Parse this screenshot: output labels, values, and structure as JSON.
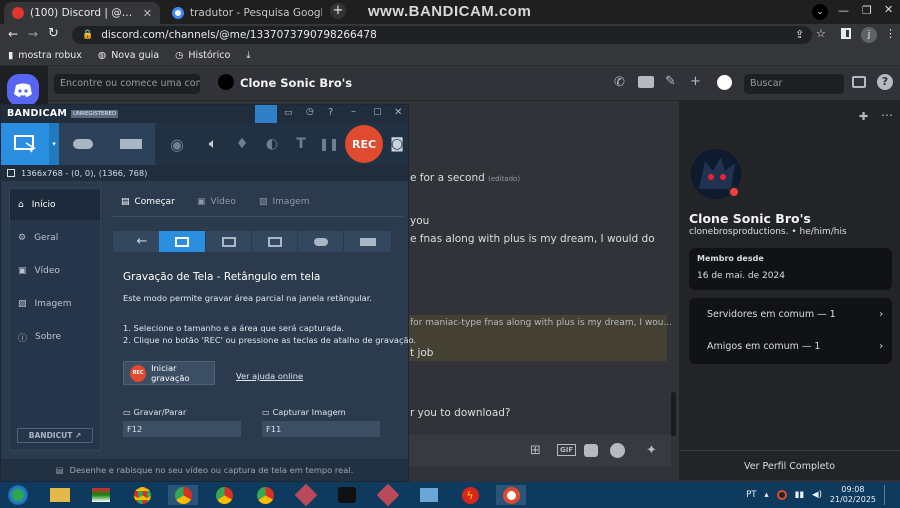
{
  "watermark": "www.BANDICAM.com",
  "browser": {
    "tabs": [
      {
        "title": "(100) Discord | @Clone Sonic Bro's",
        "favicon_color": "#e0342c"
      },
      {
        "title": "tradutor - Pesquisa Google",
        "favicon_color": "#ffffff"
      }
    ],
    "url": "discord.com/channels/@me/1337073790798266478",
    "profile_letter": "j",
    "bookmarks": [
      "mostra robux",
      "Nova guia",
      "Histórico"
    ]
  },
  "discord": {
    "search_dm_placeholder": "Encontre ou comece uma conver…",
    "channel_name": "Clone Sonic Bro's",
    "search_placeholder": "Buscar",
    "messages": [
      {
        "text": "e for a second",
        "edited": "(editado)"
      },
      {
        "text": "you"
      },
      {
        "text": "e fnas along with plus is my dream, I would do"
      },
      {
        "text": "for maniac-type fnas along with plus is my dream, I wou..."
      },
      {
        "text": "t job"
      },
      {
        "text": "r you to download?"
      }
    ],
    "profile": {
      "display_name": "Clone Sonic Bro's",
      "username": "clonebrosproductions.",
      "pronouns": "he/him/his",
      "member_since_label": "Membro desde",
      "member_since": "16 de mai. de 2024",
      "mutual_servers": "Servidores em comum — 1",
      "mutual_friends": "Amigos em comum — 1",
      "view_full_profile": "Ver Perfil Completo"
    }
  },
  "bandicam": {
    "brand": "BANDICAM",
    "badge": "UNREGISTERED",
    "rec_label": "REC",
    "resolution": "1366x768 - (0, 0), (1366, 768)",
    "sidebar": [
      "Início",
      "Geral",
      "Vídeo",
      "Imagem",
      "Sobre"
    ],
    "bandicut": "BANDICUT ↗",
    "tabs": [
      "Começar",
      "Vídeo",
      "Imagem"
    ],
    "heading": "Gravação de Tela - Retângulo em tela",
    "description": "Este modo permite gravar área parcial na janela retângular.",
    "steps": [
      "1. Selecione o tamanho e a área que será capturada.",
      "2. Clique no botão 'REC' ou pressione as teclas de atalho de gravação."
    ],
    "start_button": "Iniciar gravação",
    "help_link": "Ver ajuda online",
    "hotkey_record_label": "Gravar/Parar",
    "hotkey_record": "F12",
    "hotkey_capture_label": "Capturar Imagem",
    "hotkey_capture": "F11",
    "footer": "Desenhe e rabisque no seu vídeo ou captura de tela em tempo real."
  },
  "taskbar": {
    "language": "PT",
    "time": "09:08",
    "date": "21/02/2025"
  }
}
